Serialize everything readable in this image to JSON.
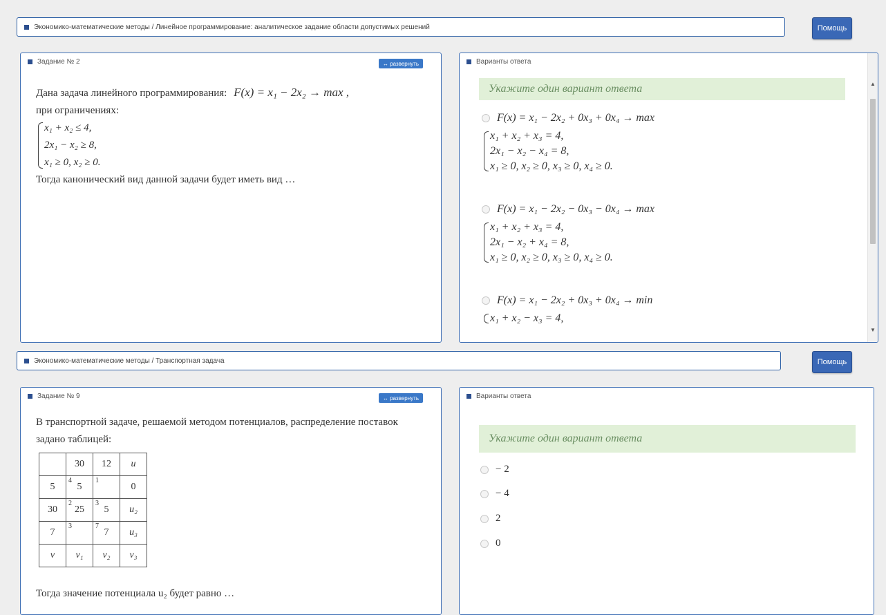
{
  "top": {
    "breadcrumb": "Экономико-математические методы / Линейное программирование: аналитическое задание области допустимых решений",
    "help_label": "Помощь",
    "task_title": "Задание № 2",
    "expand_label": "↔ развернуть",
    "task_intro": "Дана задача линейного программирования:",
    "task_func": "F(x) = x₁ − 2x₂ → max ,",
    "task_constraint_intro": "при ограничениях:",
    "task_constraints": [
      "x₁ + x₂ ≤ 4,",
      "2x₁ − x₂ ≥ 8,",
      "x₁ ≥ 0, x₂ ≥ 0."
    ],
    "task_question": "Тогда канонический вид данной задачи будет иметь вид …",
    "answers_title": "Варианты ответа",
    "hint": "Укажите один вариант ответа",
    "options": [
      {
        "func": "F(x) = x₁ − 2x₂ + 0x₃ + 0x₄ → max",
        "lines": [
          "x₁ + x₂ + x₃ = 4,",
          "2x₁ − x₂ − x₄ = 8,",
          "x₁ ≥ 0, x₂ ≥ 0, x₃ ≥ 0, x₄ ≥ 0."
        ]
      },
      {
        "func": "F(x) = x₁ − 2x₂ − 0x₃ − 0x₄ → max",
        "lines": [
          "x₁ + x₂ + x₃ = 4,",
          "2x₁ − x₂ + x₄ = 8,",
          "x₁ ≥ 0, x₂ ≥ 0, x₃ ≥ 0, x₄ ≥ 0."
        ]
      },
      {
        "func": "F(x) = x₁ − 2x₂ + 0x₃ + 0x₄ → min",
        "lines": [
          "x₁ + x₂ − x₃ = 4,"
        ]
      }
    ]
  },
  "bottom": {
    "breadcrumb": "Экономико-математические методы / Транспортная задача",
    "help_label": "Помощь",
    "task_title": "Задание № 9",
    "expand_label": "↔ развернуть",
    "task_text": "В транспортной задаче, решаемой методом потенциалов, распределение поставок задано таблицей:",
    "table": [
      [
        {
          "v": ""
        },
        {
          "v": "30"
        },
        {
          "v": "12"
        },
        {
          "v": "u"
        }
      ],
      [
        {
          "v": "5"
        },
        {
          "c": "4",
          "v": "5"
        },
        {
          "c": "1",
          "v": ""
        },
        {
          "v": "0"
        }
      ],
      [
        {
          "v": "30"
        },
        {
          "c": "2",
          "v": "25"
        },
        {
          "c": "3",
          "v": "5"
        },
        {
          "v": "u₂"
        }
      ],
      [
        {
          "v": "7"
        },
        {
          "c": "3",
          "v": ""
        },
        {
          "c": "7",
          "v": "7"
        },
        {
          "v": "u₃"
        }
      ],
      [
        {
          "v": "v"
        },
        {
          "v": "v₁"
        },
        {
          "v": "v₂"
        },
        {
          "v": "v₃"
        }
      ]
    ],
    "task_question": "Тогда значение потенциала u₂ будет равно …",
    "answers_title": "Варианты ответа",
    "hint": "Укажите один вариант ответа",
    "options": [
      "− 2",
      "− 4",
      "2",
      "0"
    ]
  }
}
